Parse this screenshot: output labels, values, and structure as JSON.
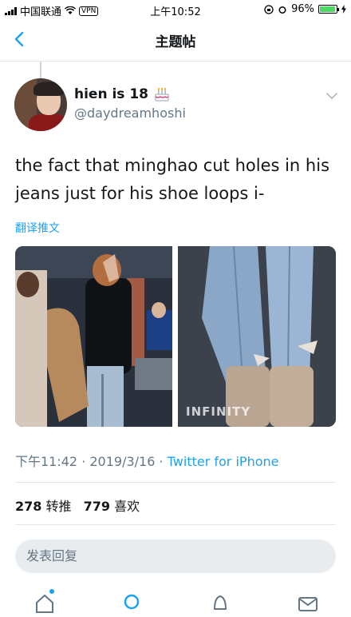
{
  "status_bar": {
    "carrier": "中国联通",
    "vpn": "VPN",
    "time": "上午10:52",
    "battery": "96%",
    "battery_level": 0.96
  },
  "nav": {
    "title": "主题帖",
    "back_icon": "chevron-left-icon"
  },
  "tweet": {
    "author_name": "hien is 18",
    "author_handle": "@daydreamhoshi",
    "text_line1": "the fact that minghao cut holes in his",
    "text_line2": "jeans just for his shoe loops i-",
    "translate": "翻译推文",
    "timestamp": "下午11:42 · 2019/3/16 · ",
    "source": "Twitter for iPhone",
    "watermark": "INFINITY",
    "retweets": "278",
    "retweets_label": "转推",
    "likes": "779",
    "likes_label": "喜欢"
  },
  "reply": {
    "placeholder": "发表回复"
  },
  "colors": {
    "accent": "#1da1f2",
    "secondary_text": "#657786",
    "divider": "#e1e8ed"
  }
}
